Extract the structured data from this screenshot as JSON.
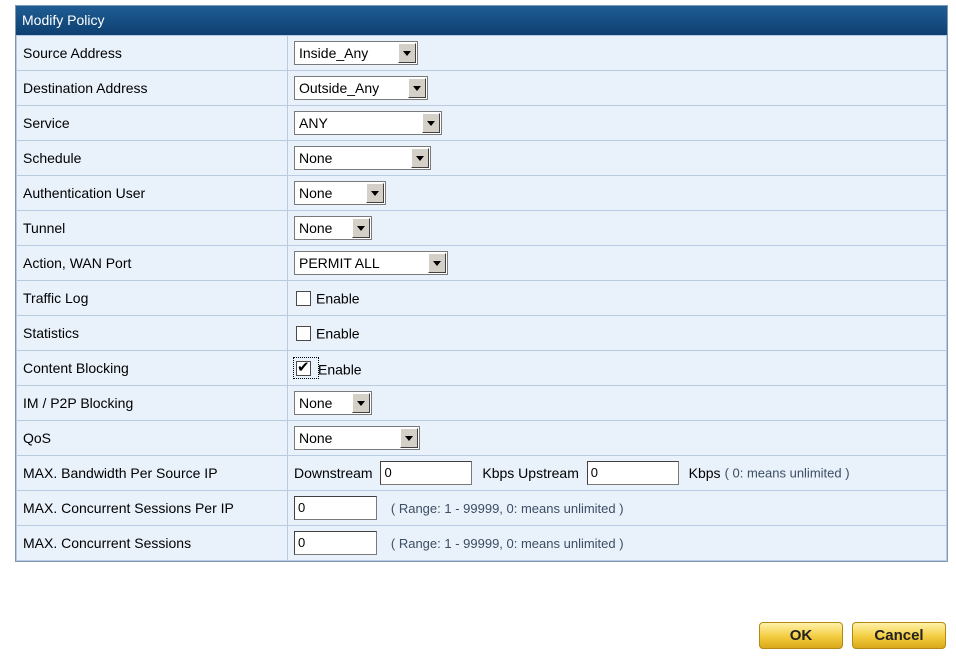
{
  "title": "Modify Policy",
  "rows": [
    {
      "label": "Source Address",
      "select": "Inside_Any"
    },
    {
      "label": "Destination Address",
      "select": "Outside_Any"
    },
    {
      "label": "Service",
      "select": "ANY"
    },
    {
      "label": "Schedule",
      "select": "None"
    },
    {
      "label": "Authentication User",
      "select": "None"
    },
    {
      "label": "Tunnel",
      "select": "None"
    },
    {
      "label": "Action, WAN Port",
      "select": "PERMIT ALL"
    },
    {
      "label": "Traffic Log",
      "checkbox_label": "Enable",
      "checked": false
    },
    {
      "label": "Statistics",
      "checkbox_label": "Enable",
      "checked": false
    },
    {
      "label": "Content Blocking",
      "checkbox_label": "Enable",
      "checked": true
    },
    {
      "label": "IM / P2P Blocking",
      "select": "None"
    },
    {
      "label": "QoS",
      "select": "None"
    },
    {
      "label": "MAX. Bandwidth Per Source IP",
      "downstream_label": "Downstream",
      "downstream_value": "0",
      "upstream_label": "Kbps Upstream",
      "upstream_value": "0",
      "unit_label": "Kbps",
      "hint": "( 0: means unlimited )"
    },
    {
      "label": "MAX. Concurrent Sessions Per IP",
      "value": "0",
      "hint": "( Range: 1 - 99999, 0: means unlimited )"
    },
    {
      "label": "MAX. Concurrent Sessions",
      "value": "0",
      "hint": "( Range: 1 - 99999, 0: means unlimited )"
    }
  ],
  "buttons": {
    "ok": "OK",
    "cancel": "Cancel"
  }
}
